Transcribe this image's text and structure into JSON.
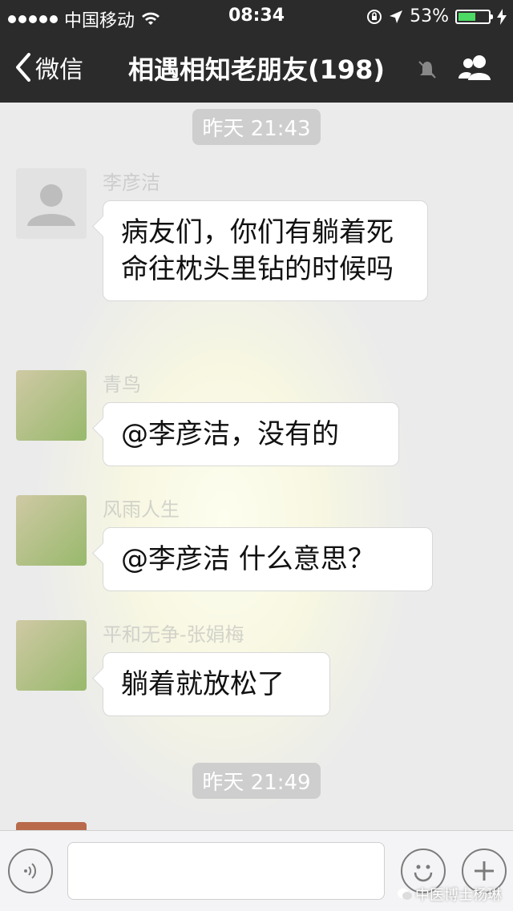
{
  "status_bar": {
    "carrier": "中国移动",
    "time": "08:34",
    "battery": "53%"
  },
  "nav": {
    "back_label": "微信",
    "title": "相遇相知老朋友(198)"
  },
  "chat": {
    "timestamps": [
      "昨天 21:43",
      "昨天 21:49"
    ],
    "messages": [
      {
        "sender": "李彦洁",
        "text": "病友们，你们有躺着死命往枕头里钻的时候吗"
      },
      {
        "sender": "青鸟",
        "text": "@李彦洁，没有的"
      },
      {
        "sender": "风雨人生",
        "text": "@李彦洁 什么意思？"
      },
      {
        "sender": "平和无争-张娟梅",
        "text": "躺着就放松了"
      }
    ]
  },
  "input_bar": {
    "watermark": "中医博士杨琳"
  },
  "colors": {
    "nav_bg": "#2b2b2c",
    "chat_bg": "#ebebeb",
    "battery": "#4cd964"
  }
}
